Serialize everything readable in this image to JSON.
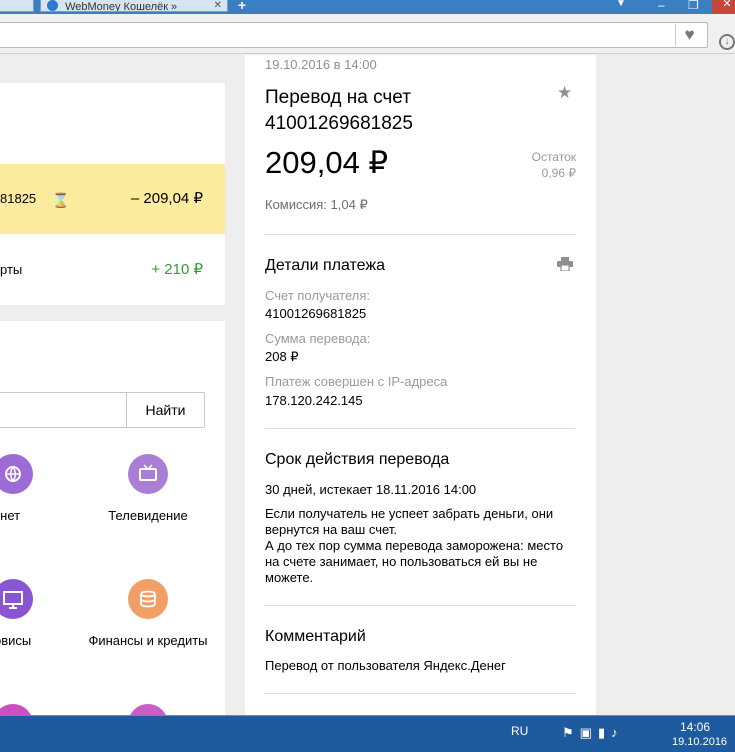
{
  "browser": {
    "tab_prev_label": "",
    "tab_active_label": "WebMoney Кошелёк »",
    "new_tab_symbol": "+",
    "address": ""
  },
  "history": {
    "pending_row": {
      "account": "81825",
      "amount": "– 209,04 ₽"
    },
    "card_row": {
      "title": "рты",
      "amount": "+ 210 ₽"
    }
  },
  "services": {
    "search_placeholder": "",
    "search_button": "Найти",
    "items": [
      {
        "label": "тернет",
        "color": "#9c6bd6"
      },
      {
        "label": "Телевидение",
        "color": "#a97ed4"
      },
      {
        "label": "н-сервисы",
        "color": "#8a55d0"
      },
      {
        "label": "Финансы и кредиты",
        "color": "#f0a066"
      },
      {
        "label": "",
        "color": "#cc4fc0"
      },
      {
        "label": "",
        "color": "#c85fc4"
      }
    ]
  },
  "detail": {
    "date": "19.10.2016 в 14:00",
    "title": "Перевод на счет 41001269681825",
    "amount": "209,04 ₽",
    "rest_label": "Остаток",
    "rest_value": "0,96 ₽",
    "fee": "Комиссия: 1,04 ₽",
    "payment_details": {
      "heading": "Детали платежа",
      "recipient_label": "Счет получателя:",
      "recipient_value": "41001269681825",
      "sum_label": "Сумма перевода:",
      "sum_value": "208 ₽",
      "ip_label": "Платеж совершен с IP-адреса",
      "ip_value": "178.120.242.145"
    },
    "validity": {
      "heading": "Срок действия перевода",
      "term": "30 дней, истекает 18.11.2016 14:00",
      "note_1": "Если получатель не успеет забрать деньги, они вернутся на ваш счет.",
      "note_2": "А до тех пор сумма перевода заморожена: место на счете занимает, но пользоваться ей вы не можете."
    },
    "comment": {
      "heading": "Комментарий",
      "text": "Перевод от пользователя Яндекс.Денег"
    }
  },
  "taskbar": {
    "language": "RU",
    "time": "14:06",
    "date": "19.10.2016"
  }
}
